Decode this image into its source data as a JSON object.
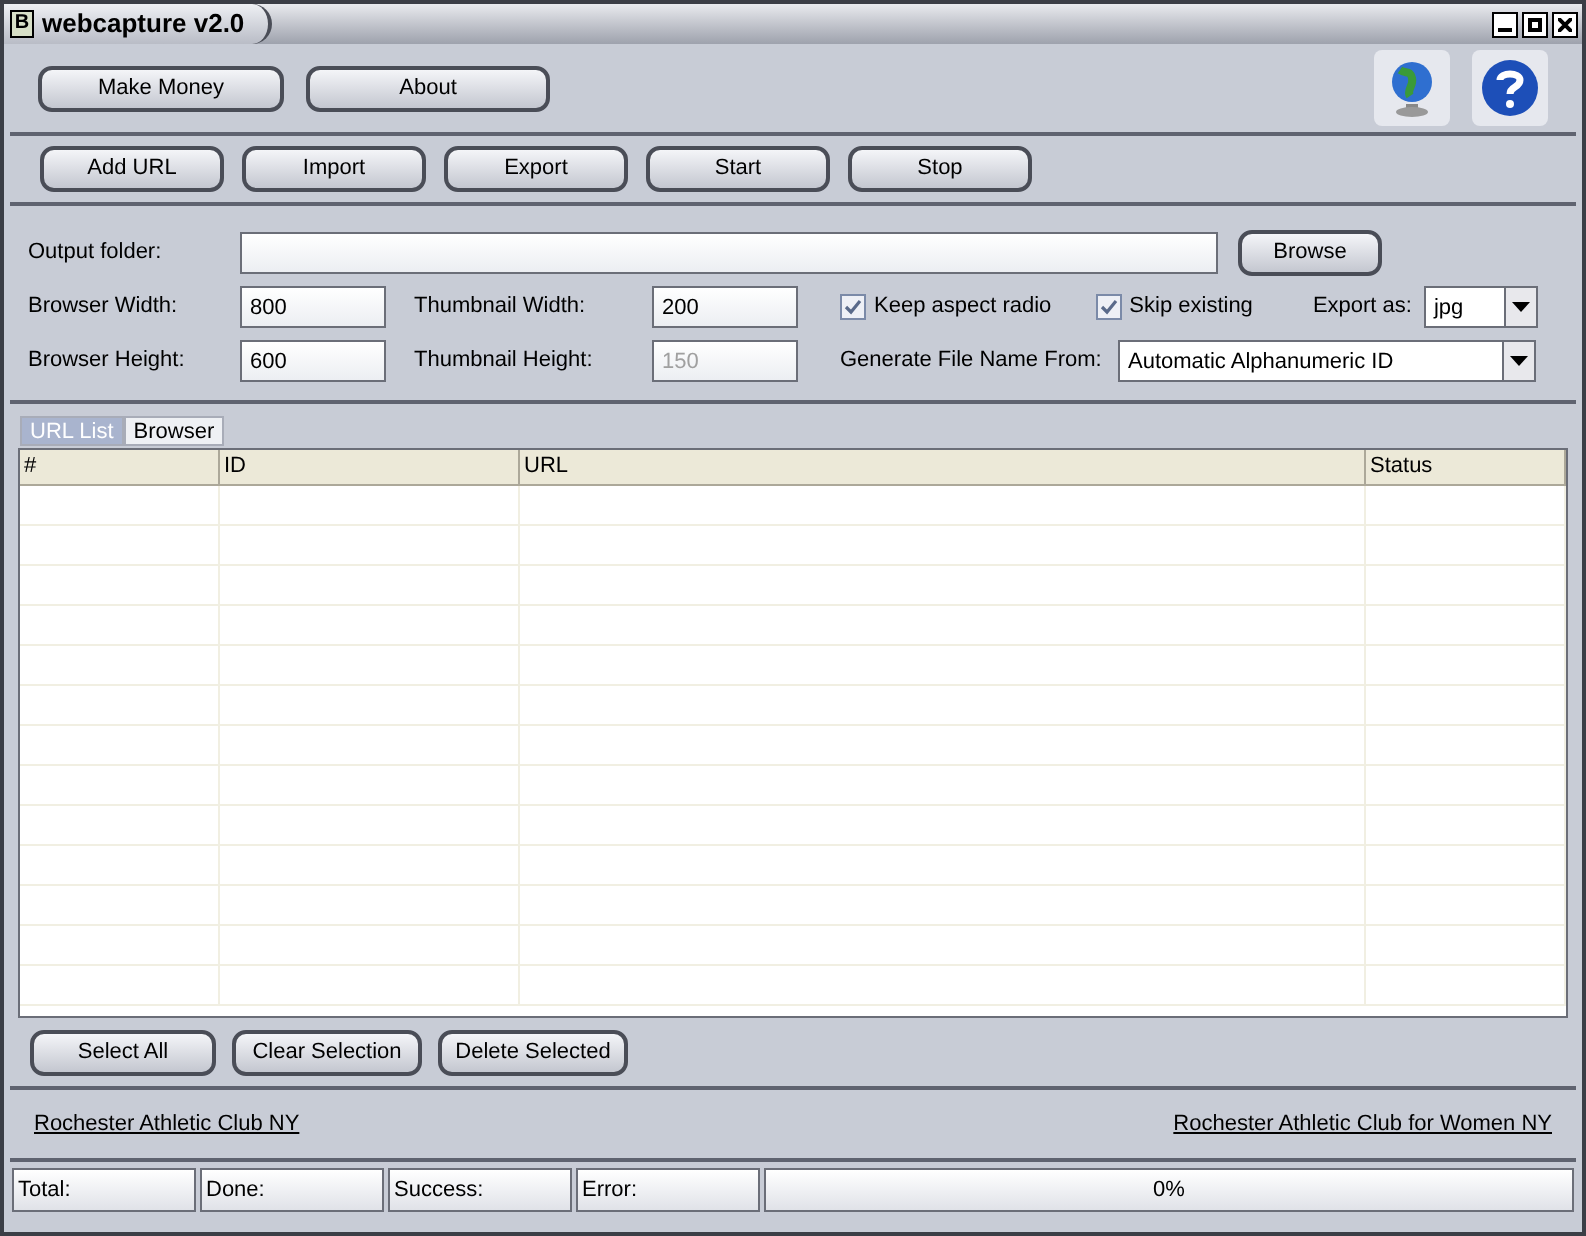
{
  "window": {
    "title": "webcapture v2.0",
    "app_icon": "B"
  },
  "top_buttons": [
    "Make Money",
    "About"
  ],
  "toolbar": [
    "Add URL",
    "Import",
    "Export",
    "Start",
    "Stop"
  ],
  "output_folder": {
    "label": "Output folder:",
    "button": "Browse"
  },
  "fields": [
    {
      "label": "Browser Width:",
      "value": "800",
      "disabled": false
    },
    {
      "label": "Thumbnail Width:",
      "value": "200",
      "disabled": false
    },
    {
      "label": "Browser Height:",
      "value": "600",
      "disabled": false
    },
    {
      "label": "Thumbnail Height:",
      "value": "150",
      "disabled": true
    }
  ],
  "checkboxes": [
    {
      "label": "Keep aspect radio",
      "checked": true
    },
    {
      "label": "Skip existing",
      "checked": true
    }
  ],
  "export_as": {
    "label": "Export as:",
    "value": "jpg"
  },
  "file_name_from": {
    "label": "Generate File Name From:",
    "value": "Automatic Alphanumeric ID"
  },
  "tabs": [
    {
      "label": "URL List",
      "selected": true
    },
    {
      "label": "Browser",
      "selected": false
    }
  ],
  "table": {
    "columns": [
      "#",
      "ID",
      "URL",
      "Status"
    ]
  },
  "list_buttons": [
    "Select All",
    "Clear Selection",
    "Delete Selected"
  ],
  "links": [
    "Rochester Athletic Club NY",
    "Rochester Athletic Club for Women NY"
  ],
  "status_bar": {
    "cells": [
      "Total:",
      "Done:",
      "Success:",
      "Error:"
    ],
    "progress": {
      "level": 0,
      "reading": "0%"
    }
  }
}
